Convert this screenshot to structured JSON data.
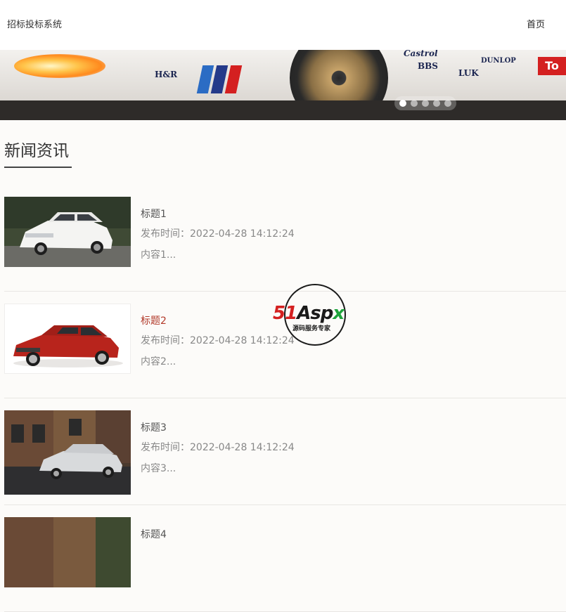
{
  "header": {
    "site_title": "招标投标系统",
    "nav_home": "首页"
  },
  "banner": {
    "sponsors": [
      "H&R",
      "Castrol",
      "BBS",
      "DUNLOP",
      "LUK",
      "To"
    ],
    "slide_count": 5,
    "active_slide": 1
  },
  "section": {
    "title": "新闻资讯"
  },
  "news": [
    {
      "title": "标题1",
      "time": "发布时间：2022-04-28 14:12:24",
      "excerpt": "内容1..."
    },
    {
      "title": "标题2",
      "time": "发布时间：2022-04-28 14:12:24",
      "excerpt": "内容2..."
    },
    {
      "title": "标题3",
      "time": "发布时间：2022-04-28 14:12:24",
      "excerpt": "内容3..."
    },
    {
      "title": "标题4",
      "time": "",
      "excerpt": ""
    }
  ],
  "watermark": {
    "brand": "51Aspx",
    "tagline": "源码服务专家"
  },
  "colors": {
    "hover_title": "#b23a2a",
    "watermark_red": "#d42020",
    "watermark_green": "#1ea43c"
  }
}
